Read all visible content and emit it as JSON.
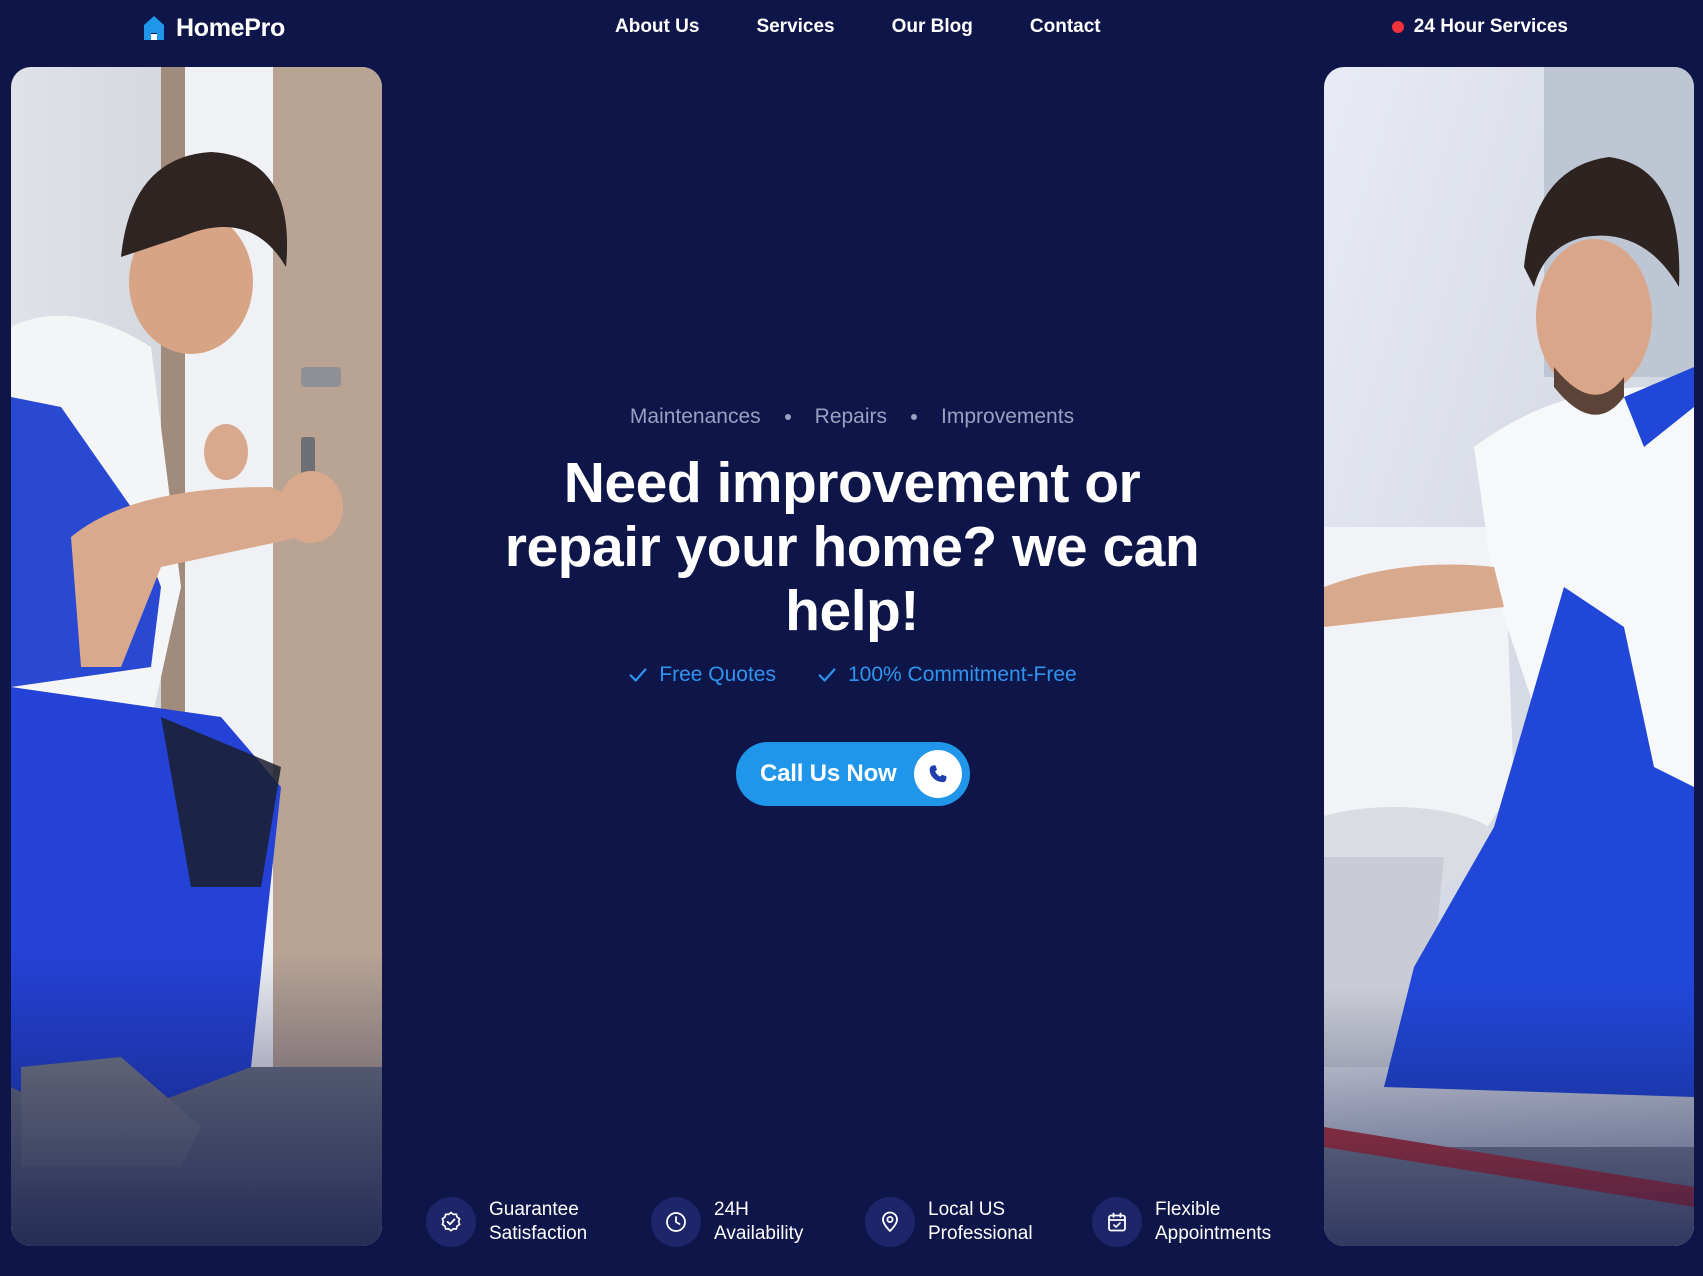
{
  "brand": {
    "name": "HomePro",
    "icon": "house-icon",
    "color": "#1f96ea"
  },
  "nav": {
    "items": [
      {
        "label": "About Us"
      },
      {
        "label": "Services"
      },
      {
        "label": "Our Blog"
      },
      {
        "label": "Contact"
      }
    ]
  },
  "status": {
    "label": "24 Hour Services",
    "dot_color": "#f0323c"
  },
  "hero": {
    "tagline": [
      "Maintenances",
      "Repairs",
      "Improvements"
    ],
    "headline_lines": [
      "Need improvement or",
      "repair your home? we can",
      "help!"
    ],
    "checks": [
      {
        "icon": "check-icon",
        "label": "Free Quotes"
      },
      {
        "icon": "check-icon",
        "label": "100% Commitment-Free"
      }
    ],
    "cta": {
      "label": "Call Us Now",
      "icon": "phone-icon"
    }
  },
  "features": [
    {
      "icon": "badge-check-icon",
      "line1": "Guarantee",
      "line2": "Satisfaction"
    },
    {
      "icon": "clock-icon",
      "line1": "24H",
      "line2": "Availability"
    },
    {
      "icon": "map-pin-icon",
      "line1": "Local US",
      "line2": "Professional"
    },
    {
      "icon": "calendar-icon",
      "line1": "Flexible",
      "line2": "Appointments"
    }
  ],
  "theme": {
    "background": "#0e1548",
    "accent": "#1f96ea",
    "muted_text": "#9aa0bf",
    "check_color": "#2e94ee"
  }
}
